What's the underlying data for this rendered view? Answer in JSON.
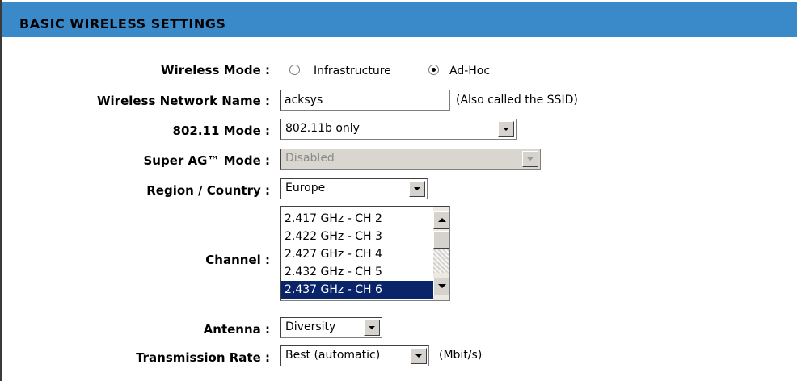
{
  "section_title": "BASIC WIRELESS SETTINGS",
  "wireless_mode": {
    "label": "Wireless Mode :",
    "options": [
      "Infrastructure",
      "Ad-Hoc"
    ],
    "selected": "Ad-Hoc"
  },
  "network_name": {
    "label": "Wireless Network Name :",
    "value": "acksys",
    "hint": "(Also called the SSID)"
  },
  "mode_80211": {
    "label": "802.11 Mode :",
    "value": "802.11b only"
  },
  "super_ag": {
    "label": "Super AG™ Mode :",
    "value": "Disabled",
    "disabled": true
  },
  "region": {
    "label": "Region / Country :",
    "value": "Europe"
  },
  "channel": {
    "label": "Channel :",
    "items": [
      "2.417 GHz - CH 2",
      "2.422 GHz - CH 3",
      "2.427 GHz - CH 4",
      "2.432 GHz - CH 5",
      "2.437 GHz - CH 6"
    ],
    "selected": "2.437 GHz - CH 6"
  },
  "antenna": {
    "label": "Antenna :",
    "value": "Diversity"
  },
  "tx_rate": {
    "label": "Transmission Rate :",
    "value": "Best (automatic)",
    "unit": "(Mbit/s)"
  },
  "colors": {
    "header_bg": "#3a89c9",
    "selection_bg": "#0a246a",
    "disabled_bg": "#d9d6cf"
  }
}
